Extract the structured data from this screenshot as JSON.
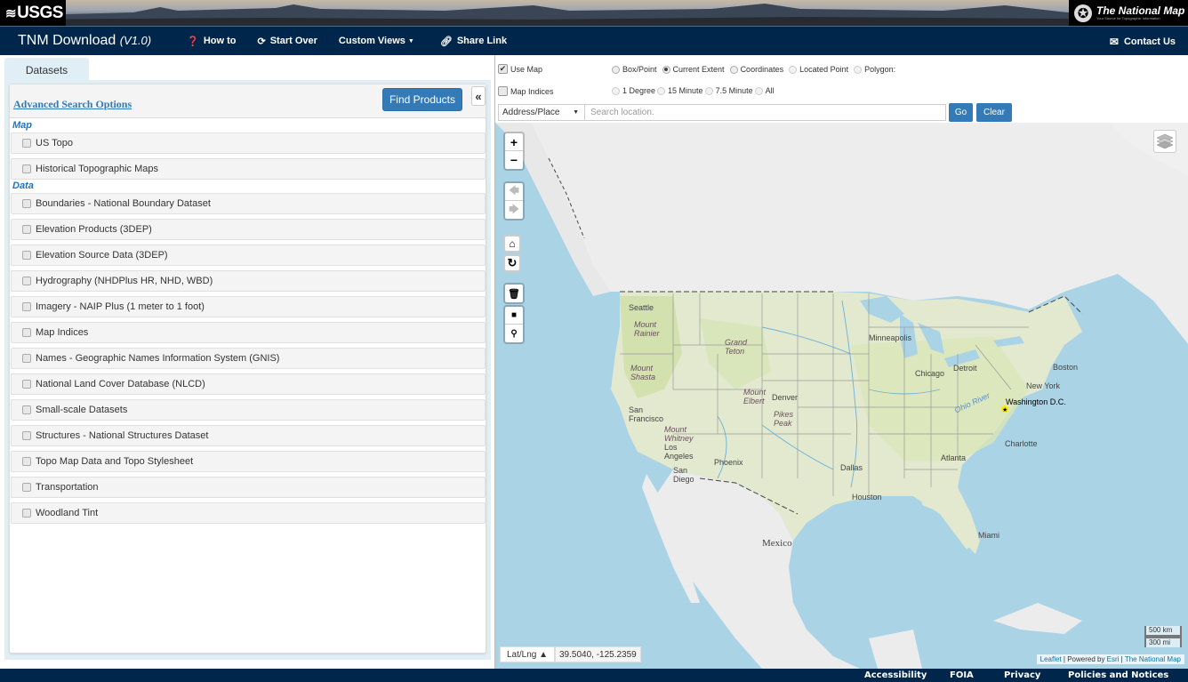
{
  "banner": {
    "usgs_logo": "USGS",
    "tnm_logo_title": "The National Map",
    "tnm_logo_tagline": "Your Source for Topographic Information"
  },
  "navbar": {
    "title": "TNM Download",
    "version": "(V1.0)",
    "links": [
      {
        "label": "How to",
        "icon": "question-circle-icon"
      },
      {
        "label": "Start Over",
        "icon": "refresh-icon"
      },
      {
        "label": "Custom Views",
        "icon": "caret-down-icon"
      },
      {
        "label": "Share Link",
        "icon": "link-icon"
      }
    ],
    "contact": {
      "label": "Contact Us",
      "icon": "envelope-icon"
    }
  },
  "left_panel": {
    "tab": "Datasets",
    "advanced_search": "Advanced Search Options",
    "find_products": "Find Products",
    "collapse_label": "«",
    "groups": [
      {
        "label": "Map",
        "items": [
          "US Topo",
          "Historical Topographic Maps"
        ]
      },
      {
        "label": "Data",
        "items": [
          "Boundaries - National Boundary Dataset",
          "Elevation Products (3DEP)",
          "Elevation Source Data (3DEP)",
          "Hydrography (NHDPlus HR, NHD, WBD)",
          "Imagery - NAIP Plus (1 meter to 1 foot)",
          "Map Indices",
          "Names - Geographic Names Information System (GNIS)",
          "National Land Cover Database (NLCD)",
          "Small-scale Datasets",
          "Structures - National Structures Dataset",
          "Topo Map Data and Topo Stylesheet",
          "Transportation",
          "Woodland Tint"
        ]
      }
    ]
  },
  "map_tools": {
    "use_map": {
      "label": "Use Map",
      "checked": true
    },
    "map_indices": {
      "label": "Map Indices",
      "checked": false
    },
    "extent_options": [
      {
        "label": "Box/Point",
        "selected": false,
        "enabled": true
      },
      {
        "label": "Current Extent",
        "selected": true,
        "enabled": true
      },
      {
        "label": "Coordinates",
        "selected": false,
        "enabled": true
      },
      {
        "label": "Located Point",
        "selected": false,
        "enabled": false
      },
      {
        "label": "Polygon:",
        "selected": false,
        "enabled": false
      }
    ],
    "index_options": [
      {
        "label": "1 Degree"
      },
      {
        "label": "15 Minute"
      },
      {
        "label": "7.5 Minute"
      },
      {
        "label": "All"
      }
    ],
    "search_type": "Address/Place",
    "search_placeholder": "Search location.",
    "search_value": "",
    "go_label": "Go",
    "clear_label": "Clear"
  },
  "map": {
    "zoom_in": "+",
    "zoom_out": "−",
    "controls": [
      "back-icon",
      "forward-icon",
      "home-icon",
      "refresh-icon",
      "trash-icon",
      "square-icon",
      "map-marker-icon"
    ],
    "labels": {
      "seattle": "Seattle",
      "mount_rainier": "Mount Rainier",
      "grand_teton": "Grand Teton",
      "mount_shasta": "Mount Shasta",
      "san_francisco": "San Francisco",
      "mount_whitney": "Mount Whitney",
      "los_angeles": "Los Angeles",
      "san_diego": "San Diego",
      "phoenix": "Phoenix",
      "mount_elbert": "Mount Elbert",
      "denver": "Denver",
      "pikes_peak": "Pikes Peak",
      "minneapolis": "Minneapolis",
      "chicago": "Chicago",
      "detroit": "Detroit",
      "boston": "Boston",
      "new_york": "New York",
      "washington": "Washington D.C.",
      "ohio_river": "Ohio River",
      "charlotte": "Charlotte",
      "atlanta": "Atlanta",
      "dallas": "Dallas",
      "houston": "Houston",
      "miami": "Miami",
      "mexico": "Mexico"
    },
    "coord_mode": "Lat/Lng ▲",
    "coord_value": "39.5040, -125.2359",
    "scale_km": "500 km",
    "scale_mi": "300 mi",
    "attribution": {
      "leaflet": "Leaflet",
      "powered": " | Powered by ",
      "esri": "Esri",
      "sep": " | ",
      "tnm": "The National Map"
    },
    "colors": {
      "water": "#aad3e6",
      "land": "#e9ecd9",
      "vegetation": "#d3e3b0",
      "terrain": "#ededed"
    }
  },
  "footer": {
    "links": [
      "Accessibility",
      "FOIA",
      "Privacy",
      "Policies and Notices"
    ]
  }
}
